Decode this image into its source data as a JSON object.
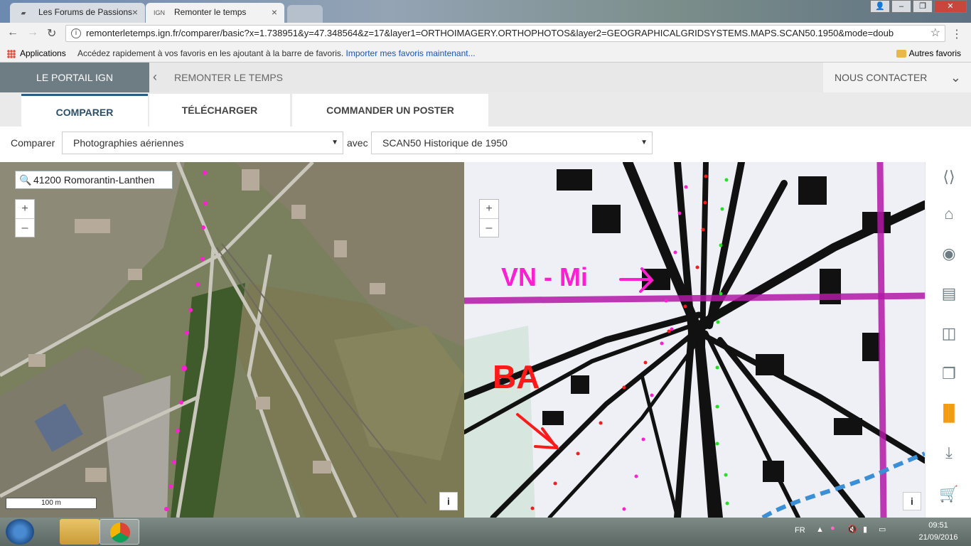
{
  "browser": {
    "tabs": [
      {
        "title": "Les Forums de Passions",
        "active": false
      },
      {
        "favicon_text": "IGN",
        "title": "Remonter le temps",
        "active": true
      }
    ],
    "url": "remonterletemps.ign.fr/comparer/basic?x=1.738951&y=47.348564&z=17&layer1=ORTHOIMAGERY.ORTHOPHOTOS&layer2=GEOGRAPHICALGRIDSYSTEMS.MAPS.SCAN50.1950&mode=doub",
    "bookmarks": {
      "apps": "Applications",
      "hint": "Accédez rapidement à vos favoris en les ajoutant à la barre de favoris.",
      "import_link": "Importer mes favoris maintenant...",
      "other": "Autres favoris"
    }
  },
  "ign": {
    "portal": "LE PORTAIL IGN",
    "section": "REMONTER LE TEMPS",
    "contact": "NOUS CONTACTER",
    "tabs": [
      "COMPARER",
      "TÉLÉCHARGER",
      "COMMANDER UN POSTER"
    ],
    "compare_label": "Comparer",
    "with_label": "avec",
    "layer1": "Photographies aériennes",
    "layer2": "SCAN50 Historique de 1950",
    "search_value": "41200 Romorantin-Lanthen",
    "zoom_in": "+",
    "zoom_out": "–",
    "info": "i",
    "scale": "100 m"
  },
  "annotations": {
    "label_1": "VN - Mi",
    "label_2": "BA",
    "magenta": "#ff1fd2",
    "red": "#ff1a1a",
    "green": "#22e022"
  },
  "sidebar_icons": [
    "share-icon",
    "home-icon",
    "camera-icon",
    "layers-icon",
    "split-icon",
    "windows-icon",
    "compare-icon",
    "download-icon",
    "cart-icon"
  ],
  "taskbar": {
    "language": "FR",
    "time": "09:51",
    "date": "21/09/2016"
  }
}
